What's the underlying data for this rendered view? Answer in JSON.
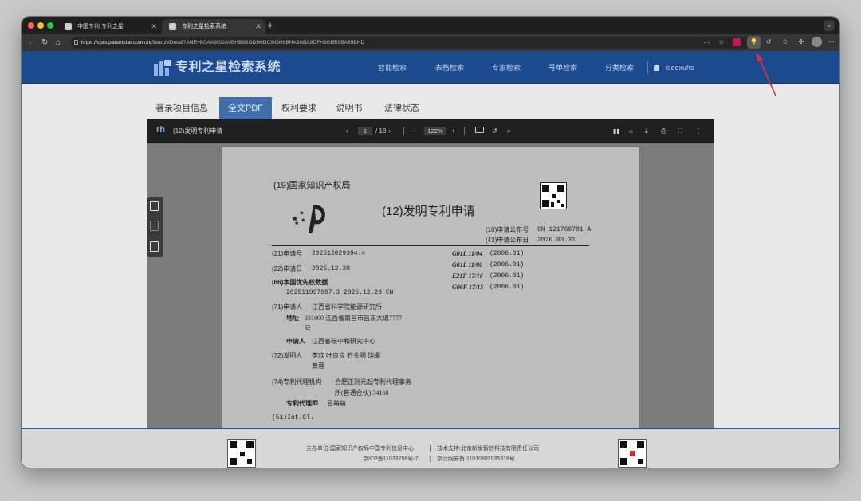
{
  "browser": {
    "tabs": [
      {
        "title": "中国专利 专利之星"
      },
      {
        "title": "专利之星检索系统"
      }
    ],
    "new_tab": "+",
    "url_host": "https://cprs.patentstar.com.cn",
    "url_path": "/Search/Detail?ANE=8GAA9GDA9BHB9BGD9HDC9IGH8BHA3ABA9CFH9GBB9BA89BHD"
  },
  "site": {
    "brand": "专利之星检索系统",
    "nav": [
      "智能检索",
      "表格检索",
      "专家检索",
      "号单检索",
      "分类检索"
    ],
    "user": "iseexuhs"
  },
  "detail_tabs": [
    {
      "label": "著录项目信息"
    },
    {
      "label": "全文PDF"
    },
    {
      "label": "权利要求"
    },
    {
      "label": "说明书"
    },
    {
      "label": "法律状态"
    }
  ],
  "viewer": {
    "title": "(12)发明专利申请",
    "page_current": "1",
    "page_total": "/ 18",
    "zoom": "122%"
  },
  "document": {
    "office": "(19)国家知识产权局",
    "kind": "(12)发明专利申请",
    "pub_no_label": "(10)申请公布号",
    "pub_no": "CN 121760781 A",
    "pub_date_label": "(43)申请公布日",
    "pub_date": "2026.03.31",
    "app_no_label": "(21)申请号",
    "app_no": "202512029394.4",
    "app_date_label": "(22)申请日",
    "app_date": "2025.12.30",
    "priority_label": "(66)本国优先权数据",
    "priority_value": "202511997987.3 2025.12.28 CN",
    "applicant_label": "(71)申请人",
    "applicant": "江西省科学院能源研究所",
    "address_label": "地址",
    "address_line1": "331000 江西省南昌市昌东大道7777",
    "address_line2": "号",
    "applicant2_label": "申请人",
    "applicant2": "江西省碳中和研究中心",
    "inventor_label": "(72)发明人",
    "inventors_line1": "李欢   叶良良   石金明   饶娜",
    "inventors_line2": "黄蓉",
    "agency_label": "(74)专利代理机构",
    "agency_line1": "合肥正则元起专利代理事务",
    "agency_line2": "所(普通合伙) 34160",
    "agent_label": "专利代理师",
    "agent": "吕萌萌",
    "intcl_label": "(51)Int.Cl.",
    "classifications": [
      {
        "code": "G01L 11/04",
        "ver": "(2006.01)"
      },
      {
        "code": "G01L 11/00",
        "ver": "(2006.01)"
      },
      {
        "code": "E21F 17/16",
        "ver": "(2006.01)"
      },
      {
        "code": "G06F 17/15",
        "ver": "(2006.01)"
      }
    ]
  },
  "footer": {
    "sponsor": "主办单位:国家知识产权局中国专利信息中心",
    "tech": "技术支持:北京新发智信科技有限责任公司",
    "icp": "京ICP备11033758号-7",
    "police": "京公网安备 11010802035318号"
  },
  "colors": {
    "header_blue": "#1b4a8e",
    "tab_active": "#3f6ea8",
    "annotation_red": "#e0303a"
  }
}
